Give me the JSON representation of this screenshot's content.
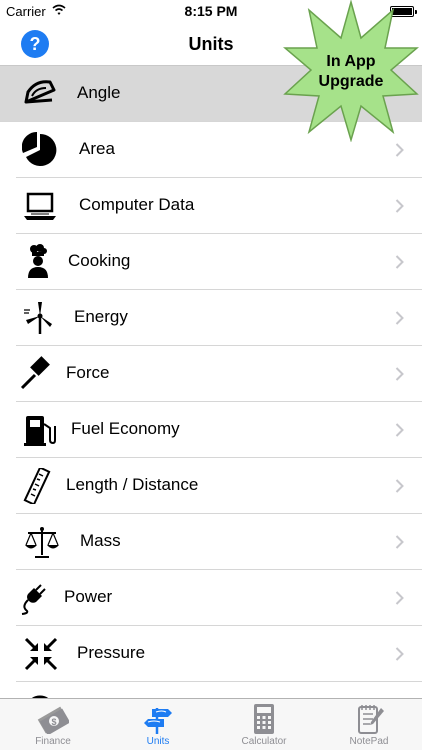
{
  "status": {
    "carrier": "Carrier",
    "time": "8:15 PM"
  },
  "nav": {
    "help": "?",
    "title": "Units"
  },
  "upgrade": {
    "line1": "In App",
    "line2": "Upgrade",
    "color": "#a6e28a"
  },
  "list": [
    {
      "label": "Angle",
      "icon": "protractor-icon"
    },
    {
      "label": "Area",
      "icon": "pie-area-icon"
    },
    {
      "label": "Computer Data",
      "icon": "laptop-icon"
    },
    {
      "label": "Cooking",
      "icon": "chef-icon"
    },
    {
      "label": "Energy",
      "icon": "wind-turbine-icon"
    },
    {
      "label": "Force",
      "icon": "gavel-icon"
    },
    {
      "label": "Fuel Economy",
      "icon": "fuel-pump-icon"
    },
    {
      "label": "Length / Distance",
      "icon": "ruler-icon"
    },
    {
      "label": "Mass",
      "icon": "scales-icon"
    },
    {
      "label": "Power",
      "icon": "power-plug-icon"
    },
    {
      "label": "Pressure",
      "icon": "pressure-arrows-icon"
    }
  ],
  "tabs": [
    {
      "label": "Finance",
      "icon": "money-icon"
    },
    {
      "label": "Units",
      "icon": "signpost-icon"
    },
    {
      "label": "Calculator",
      "icon": "calculator-icon"
    },
    {
      "label": "NotePad",
      "icon": "notepad-icon"
    }
  ],
  "colors": {
    "accent": "#1e7cf2",
    "selected_row": "#d8d8d8",
    "tab_inactive": "#8e8e93"
  }
}
